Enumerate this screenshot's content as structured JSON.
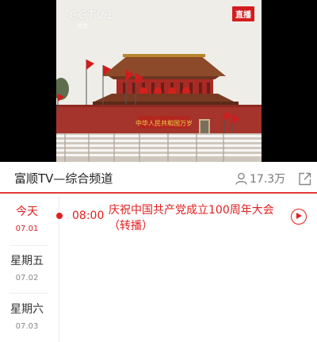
{
  "video": {
    "logo": "CCTV1",
    "logo_sub": "综合",
    "live_badge": "直播",
    "banner_text": "中华人民共和国万岁"
  },
  "channel": {
    "title": "富顺TV—综合频道",
    "viewers": "17.3万",
    "viewer_icon": "person-icon",
    "share_icon": "share-icon"
  },
  "days": [
    {
      "name": "今天",
      "date": "07.01",
      "active": true
    },
    {
      "name": "星期五",
      "date": "07.02",
      "active": false
    },
    {
      "name": "星期六",
      "date": "07.03",
      "active": false
    }
  ],
  "programs": [
    {
      "time": "08:00",
      "title": "庆祝中国共产党成立100周年大会（转播）",
      "status": "live"
    }
  ],
  "colors": {
    "accent": "#e02020",
    "divider": "#e33b3b"
  }
}
